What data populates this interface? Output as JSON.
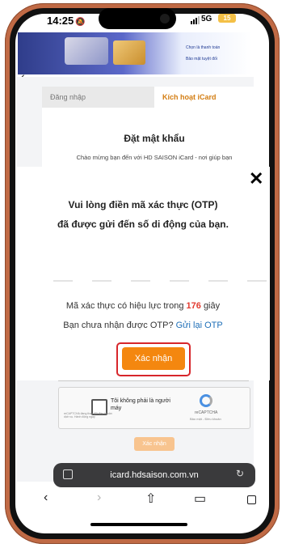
{
  "status_bar": {
    "time": "14:25",
    "network": "5G",
    "battery": "15"
  },
  "banner": {
    "promo_line_1": "Chọn là thanh toán",
    "promo_line_2": "Bảo mật tuyệt đối"
  },
  "background_page": {
    "tabs": [
      {
        "label": "Đăng nhập"
      },
      {
        "label": "Kích hoạt iCard"
      }
    ],
    "title": "Đặt mật khẩu",
    "subtitle": "Chào mừng bạn đến với HD SAISON iCard - nơi giúp bạn",
    "captcha": {
      "label": "Tôi không phải là người máy",
      "brand": "reCAPTCHA",
      "links": "Bảo mật - Điều khoản",
      "small_text": "reCAPTCHA đang thay đổi điều khoản dịch vụ. Hành động ngay"
    },
    "confirm_label": "Xác nhận"
  },
  "otp_modal": {
    "line_1": "Vui lòng điền mã xác thực (OTP)",
    "line_2": "đã được gửi đến số di động của bạn.",
    "validity_prefix": "Mã xác thực có hiệu lực trong",
    "validity_seconds": "176",
    "validity_suffix": "giây",
    "resend_prefix": "Bạn chưa nhận được OTP?",
    "resend_link": "Gửi lại OTP",
    "confirm_label": "Xác nhận",
    "otp_slots": 6
  },
  "browser": {
    "url": "icard.hdsaison.com.vn"
  },
  "icons": [
    "back-chevron-icon",
    "close-icon",
    "tabs-icon",
    "reload-icon",
    "back-icon",
    "forward-icon",
    "share-icon",
    "bookmarks-icon",
    "tab-overview-icon"
  ],
  "colors": {
    "accent": "#f4870f",
    "highlight_border": "#d7262b",
    "timer": "#e23a2f",
    "link": "#1e6fb8",
    "phone_frame": "#c06a45"
  }
}
